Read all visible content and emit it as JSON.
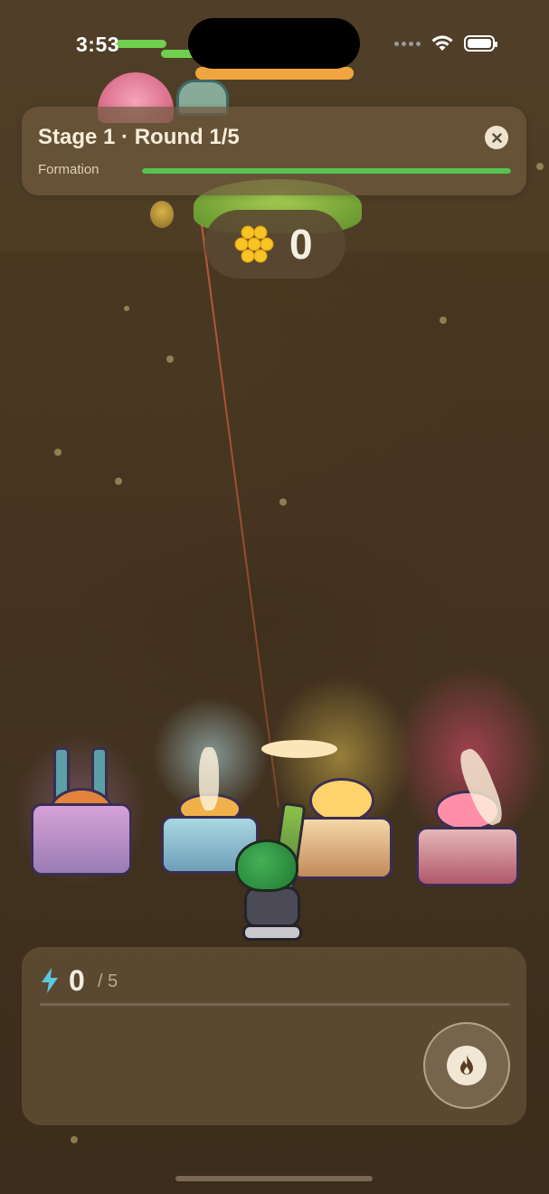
{
  "status_bar": {
    "time": "3:53"
  },
  "hud": {
    "title": "Stage 1 · Round 1/5",
    "close_icon": "close-icon",
    "progress_label": "Formation",
    "progress_fraction": 1.0,
    "progress_color": "#57c152"
  },
  "score": {
    "icon": "honeycomb-coin-icon",
    "value": "0"
  },
  "turrets": [
    {
      "name": "twin-cannon-turret",
      "color": "#c98bd0"
    },
    {
      "name": "frost-turret",
      "color": "#aee7f0"
    },
    {
      "name": "sun-turret",
      "color": "#ffd860"
    },
    {
      "name": "flame-turret",
      "color": "#ff5a8a"
    }
  ],
  "energy": {
    "icon": "lightning-icon",
    "value": "0",
    "max": "/ 5",
    "fill_fraction": 0.0,
    "color": "#5ac8e0"
  },
  "fire_button": {
    "icon": "flame-icon"
  },
  "colors": {
    "background": "#433320",
    "panel": "#6c583e",
    "accent_green": "#57c152"
  }
}
